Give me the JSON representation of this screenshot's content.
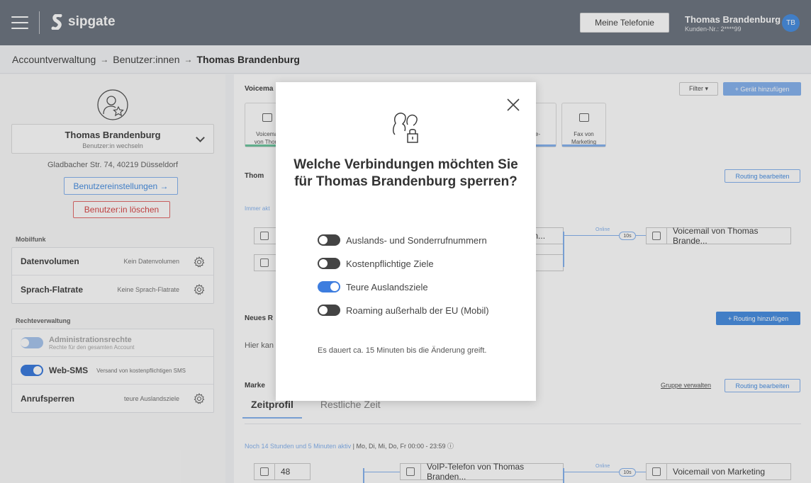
{
  "topbar": {
    "brand": "sipgate",
    "meine_telefonie": "Meine Telefonie",
    "user_name": "Thomas Brandenburg",
    "customer_no": "Kunden-Nr.: 2****99",
    "avatar_initials": "TB"
  },
  "breadcrumb": {
    "items": [
      "Accountverwaltung",
      "Benutzer:innen",
      "Thomas Brandenburg"
    ],
    "separator": "→"
  },
  "sidebar": {
    "user_name": "Thomas Brandenburg",
    "switch_user": "Benutzer:in wechseln",
    "address": "Gladbacher Str. 74, 40219 Düsseldorf",
    "settings_button": "Benutzereinstellungen →",
    "delete_button": "Benutzer:in löschen",
    "mobilfunk_label": "Mobilfunk",
    "mobilfunk_rows": [
      {
        "label": "Datenvolumen",
        "value": "Kein Datenvolumen"
      },
      {
        "label": "Sprach-Flatrate",
        "value": "Keine Sprach-Flatrate"
      }
    ],
    "rights_label": "Rechteverwaltung",
    "admin_title": "Administrationsrechte",
    "admin_desc": "Rechte für den gesamten Account",
    "websms_title": "Web-SMS",
    "websms_desc": "Versand von kostenpflichtigen SMS",
    "callblock_title": "Anrufsperren",
    "callblock_value": "teure Auslandsziele"
  },
  "main": {
    "voicemail_heading": "Voicema",
    "filter_button": "Filter ▾",
    "add_device_button": "+ Gerät hinzufügen",
    "tile1": "Voicema\nvon Thom",
    "tile2": "Tele-\nn",
    "tile3": "Fax von\nMarketing",
    "thomas_heading": "Thom",
    "routing_edit": "Routing bearbeiten",
    "immer_aktiv": "Immer akt",
    "flow_middle": "den...",
    "online": "Online",
    "ten_s": "10s",
    "voicemail_thomas": "Voicemail von Thomas Brande...",
    "new_routing_heading": "Neues R",
    "add_routing": "+ Routing hinzufügen",
    "hier_kann": "Hier kan",
    "marketing_heading": "Marke",
    "group_manage": "Gruppe verwalten",
    "routing_edit2": "Routing bearbeiten",
    "tab_active": "Zeitprofil",
    "tab_other": "Restliche Zeit",
    "active_info_blue": "Noch 14 Stunden und 5 Minuten aktiv",
    "active_info_rest": "| Mo, Di, Mi, Do, Fr 00:00 - 23:59 ⓘ",
    "number": "48",
    "voip_phone": "VoIP-Telefon von Thomas Branden...",
    "voicemail_marketing": "Voicemail von Marketing"
  },
  "modal": {
    "title": "Welche Verbindungen möchten Sie für Thomas Brandenburg sperren?",
    "options": [
      {
        "label": "Auslands- und Sonderrufnummern",
        "on": false
      },
      {
        "label": "Kostenpflichtige Ziele",
        "on": false
      },
      {
        "label": "Teure Auslandsziele",
        "on": true
      },
      {
        "label": "Roaming außerhalb der EU (Mobil)",
        "on": false
      }
    ],
    "note": "Es dauert ca. 15 Minuten bis die Änderung greift."
  },
  "colors": {
    "topbar": "#6f7782",
    "accent": "#4a90e2",
    "toggle_on": "#3d7ddf",
    "toggle_off": "#444444",
    "danger": "#d94848"
  }
}
